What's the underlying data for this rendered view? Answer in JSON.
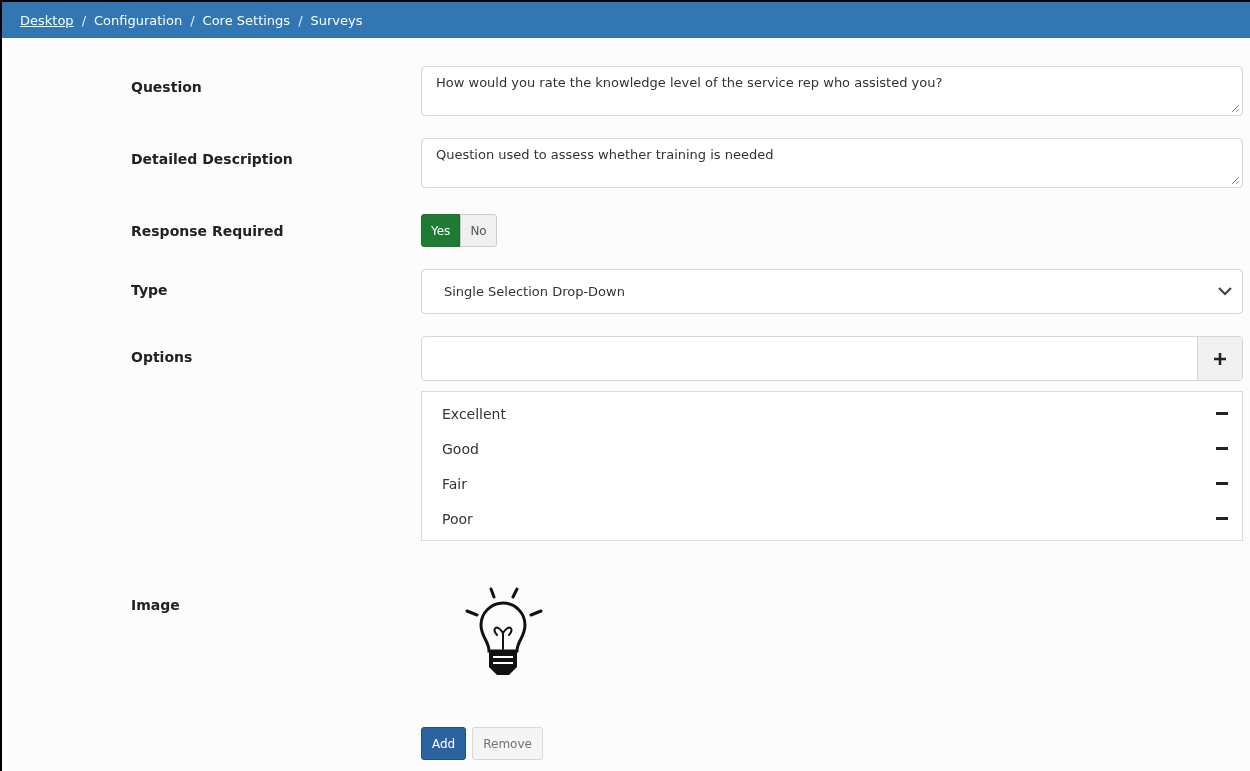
{
  "breadcrumb": [
    {
      "label": "Desktop",
      "kind": "item",
      "link": true
    },
    {
      "label": "/",
      "kind": "separator"
    },
    {
      "label": "Configuration",
      "kind": "item",
      "link": false
    },
    {
      "label": "/",
      "kind": "separator"
    },
    {
      "label": "Core Settings",
      "kind": "item",
      "link": false
    },
    {
      "label": "/",
      "kind": "separator"
    },
    {
      "label": "Surveys",
      "kind": "item",
      "link": false
    }
  ],
  "question": {
    "label": "Question",
    "value": "How would you rate the knowledge level of the service rep who assisted you?"
  },
  "description": {
    "label": "Detailed Description",
    "value": "Question used to assess whether training is needed"
  },
  "response_required": {
    "label": "Response Required",
    "options": [
      {
        "label": "Yes",
        "selected": true
      },
      {
        "label": "No",
        "selected": false
      }
    ]
  },
  "type": {
    "label": "Type",
    "value": "Single Selection Drop-Down"
  },
  "options": {
    "label": "Options",
    "items": [
      "Excellent",
      "Good",
      "Fair",
      "Poor"
    ]
  },
  "image": {
    "label": "Image",
    "buttons": [
      {
        "label": "Add",
        "kind": "primary",
        "disabled": false
      },
      {
        "label": "Remove",
        "kind": "default",
        "disabled": true
      }
    ]
  }
}
